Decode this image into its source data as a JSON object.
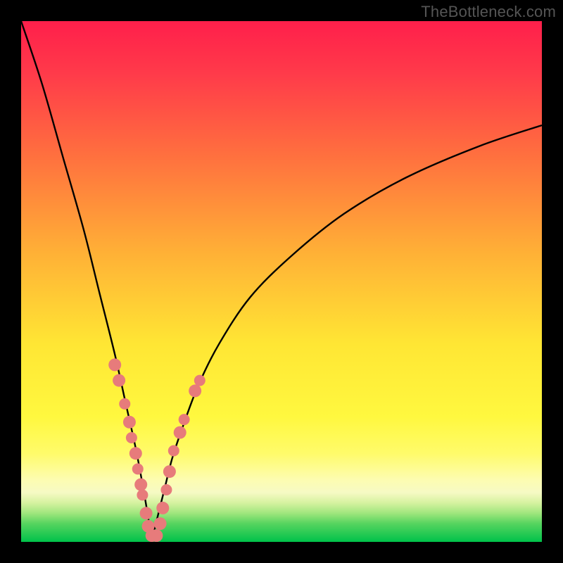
{
  "watermark": "TheBottleneck.com",
  "colors": {
    "frame": "#000000",
    "curve": "#000000",
    "dot_fill": "#e77b7b",
    "dot_stroke": "#c96363",
    "gradient_stops": [
      {
        "offset": 0.0,
        "color": "#ff1f4b"
      },
      {
        "offset": 0.1,
        "color": "#ff3a4a"
      },
      {
        "offset": 0.25,
        "color": "#ff6d3f"
      },
      {
        "offset": 0.45,
        "color": "#ffb236"
      },
      {
        "offset": 0.62,
        "color": "#ffe634"
      },
      {
        "offset": 0.76,
        "color": "#fff83f"
      },
      {
        "offset": 0.83,
        "color": "#fffb6a"
      },
      {
        "offset": 0.88,
        "color": "#fdfcb0"
      },
      {
        "offset": 0.905,
        "color": "#f6fac4"
      },
      {
        "offset": 0.925,
        "color": "#d6f2a0"
      },
      {
        "offset": 0.945,
        "color": "#9fe67d"
      },
      {
        "offset": 0.965,
        "color": "#56d45f"
      },
      {
        "offset": 1.0,
        "color": "#00c24a"
      }
    ]
  },
  "chart_data": {
    "type": "line",
    "title": "",
    "xlabel": "",
    "ylabel": "",
    "x_range": [
      0,
      100
    ],
    "y_range": [
      0,
      100
    ],
    "notch_x": 25,
    "series": [
      {
        "name": "left-branch",
        "x": [
          0,
          4,
          8,
          12,
          15,
          18,
          20,
          22,
          23.5,
          24.5,
          25
        ],
        "y": [
          100,
          88,
          74,
          60,
          48,
          36,
          27,
          18,
          10,
          4,
          0
        ]
      },
      {
        "name": "right-branch",
        "x": [
          25,
          26,
          27.5,
          29,
          31,
          34,
          38,
          44,
          52,
          62,
          74,
          88,
          100
        ],
        "y": [
          0,
          4,
          10,
          16,
          22,
          30,
          38,
          47,
          55,
          63,
          70,
          76,
          80
        ]
      }
    ],
    "dots": [
      {
        "x": 18.0,
        "y": 34.0,
        "r": 9
      },
      {
        "x": 18.8,
        "y": 31.0,
        "r": 9
      },
      {
        "x": 19.9,
        "y": 26.5,
        "r": 8
      },
      {
        "x": 20.8,
        "y": 23.0,
        "r": 9
      },
      {
        "x": 21.2,
        "y": 20.0,
        "r": 8
      },
      {
        "x": 22.0,
        "y": 17.0,
        "r": 9
      },
      {
        "x": 22.4,
        "y": 14.0,
        "r": 8
      },
      {
        "x": 23.0,
        "y": 11.0,
        "r": 9
      },
      {
        "x": 23.3,
        "y": 9.0,
        "r": 8
      },
      {
        "x": 24.0,
        "y": 5.5,
        "r": 9
      },
      {
        "x": 24.4,
        "y": 3.0,
        "r": 9
      },
      {
        "x": 25.1,
        "y": 1.2,
        "r": 9
      },
      {
        "x": 26.0,
        "y": 1.2,
        "r": 9
      },
      {
        "x": 26.7,
        "y": 3.5,
        "r": 9
      },
      {
        "x": 27.2,
        "y": 6.5,
        "r": 9
      },
      {
        "x": 27.9,
        "y": 10.0,
        "r": 8
      },
      {
        "x": 28.5,
        "y": 13.5,
        "r": 9
      },
      {
        "x": 29.3,
        "y": 17.5,
        "r": 8
      },
      {
        "x": 30.5,
        "y": 21.0,
        "r": 9
      },
      {
        "x": 31.3,
        "y": 23.5,
        "r": 8
      },
      {
        "x": 33.4,
        "y": 29.0,
        "r": 9
      },
      {
        "x": 34.3,
        "y": 31.0,
        "r": 8
      }
    ]
  }
}
